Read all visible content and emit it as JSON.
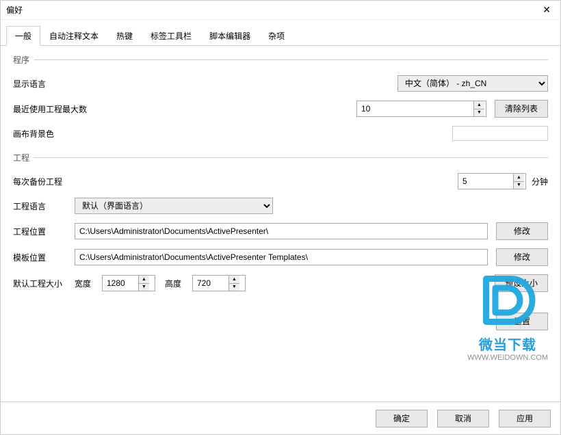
{
  "window": {
    "title": "偏好"
  },
  "tabs": {
    "items": [
      {
        "label": "一般"
      },
      {
        "label": "自动注释文本"
      },
      {
        "label": "热键"
      },
      {
        "label": "标签工具栏"
      },
      {
        "label": "脚本编辑器"
      },
      {
        "label": "杂项"
      }
    ],
    "active_index": 0
  },
  "groups": {
    "program": {
      "title": "程序",
      "display_lang_label": "显示语言",
      "display_lang_value": "中文（简体） - zh_CN",
      "recent_label": "最近使用工程最大数",
      "recent_value": "10",
      "clear_list": "清除列表",
      "canvas_bg_label": "画布背景色"
    },
    "project": {
      "title": "工程",
      "backup_label": "每次备份工程",
      "backup_value": "5",
      "backup_unit": "分钟",
      "lang_label": "工程语言",
      "lang_value": "默认（界面语言）",
      "loc_label": "工程位置",
      "loc_value": "C:\\Users\\Administrator\\Documents\\ActivePresenter\\",
      "tpl_label": "模板位置",
      "tpl_value": "C:\\Users\\Administrator\\Documents\\ActivePresenter Templates\\",
      "modify": "修改",
      "size_label": "默认工程大小",
      "width_label": "宽度",
      "width_value": "1280",
      "height_label": "高度",
      "height_value": "720",
      "preset_size": "预设大小",
      "reset": "重置"
    }
  },
  "dialog": {
    "ok": "确定",
    "cancel": "取消",
    "apply": "应用"
  },
  "watermark": {
    "text1": "微当下载",
    "text2": "WWW.WEIDOWN.COM"
  }
}
